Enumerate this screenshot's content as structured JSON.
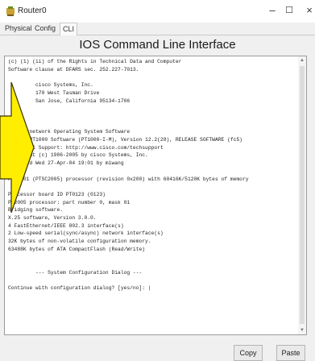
{
  "window": {
    "title": "Router0",
    "minimize_symbol": "–",
    "maximize_symbol": "☐",
    "close_symbol": "×"
  },
  "tabs": [
    {
      "label": "Physical",
      "active": false
    },
    {
      "label": "Config",
      "active": false
    },
    {
      "label": "CLI",
      "active": true
    }
  ],
  "heading": "IOS Command Line Interface",
  "console_lines": [
    "(c) (1) (ii) of the Rights in Technical Data and Computer",
    "Software clause at DFARS sec. 252.227-7013.",
    "",
    "         cisco Systems, Inc.",
    "         170 West Tasman Drive",
    "         San Jose, California 95134-1706",
    "",
    "",
    "",
    "  Internetwork Operating System Software",
    "  (tm) PT1000 Software (PT1000-I-M), Version 12.2(28), RELEASE SOFTWARE (fc5)",
    "Technical Support: http://www.cisco.com/techsupport",
    "Copyright (c) 1986-2005 by cisco Systems, Inc.",
    "Compiled Wed 27-Apr-04 19:01 by miwang",
    "",
    "PT 1001 (PTSC2005) processor (revision 0x200) with 60416K/5120K bytes of memory",
    "",
    "Processor board ID PT0123 (0123)",
    "PT2005 processor: part number 0, mask 01",
    "Bridging software.",
    "X.25 software, Version 3.0.0.",
    "4 FastEthernet/IEEE 802.3 interface(s)",
    "2 Low-speed serial(sync/async) network interface(s)",
    "32K bytes of non-volatile configuration memory.",
    "63488K bytes of ATA CompactFlash (Read/Write)",
    "",
    "",
    "         --- System Configuration Dialog ---",
    "",
    "Continue with configuration dialog? [yes/no]: |"
  ],
  "buttons": {
    "copy": "Copy",
    "paste": "Paste"
  },
  "colors": {
    "arrow_fill": "#ffee00",
    "arrow_stroke": "#3a3000",
    "console_bg": "#ffffff"
  }
}
